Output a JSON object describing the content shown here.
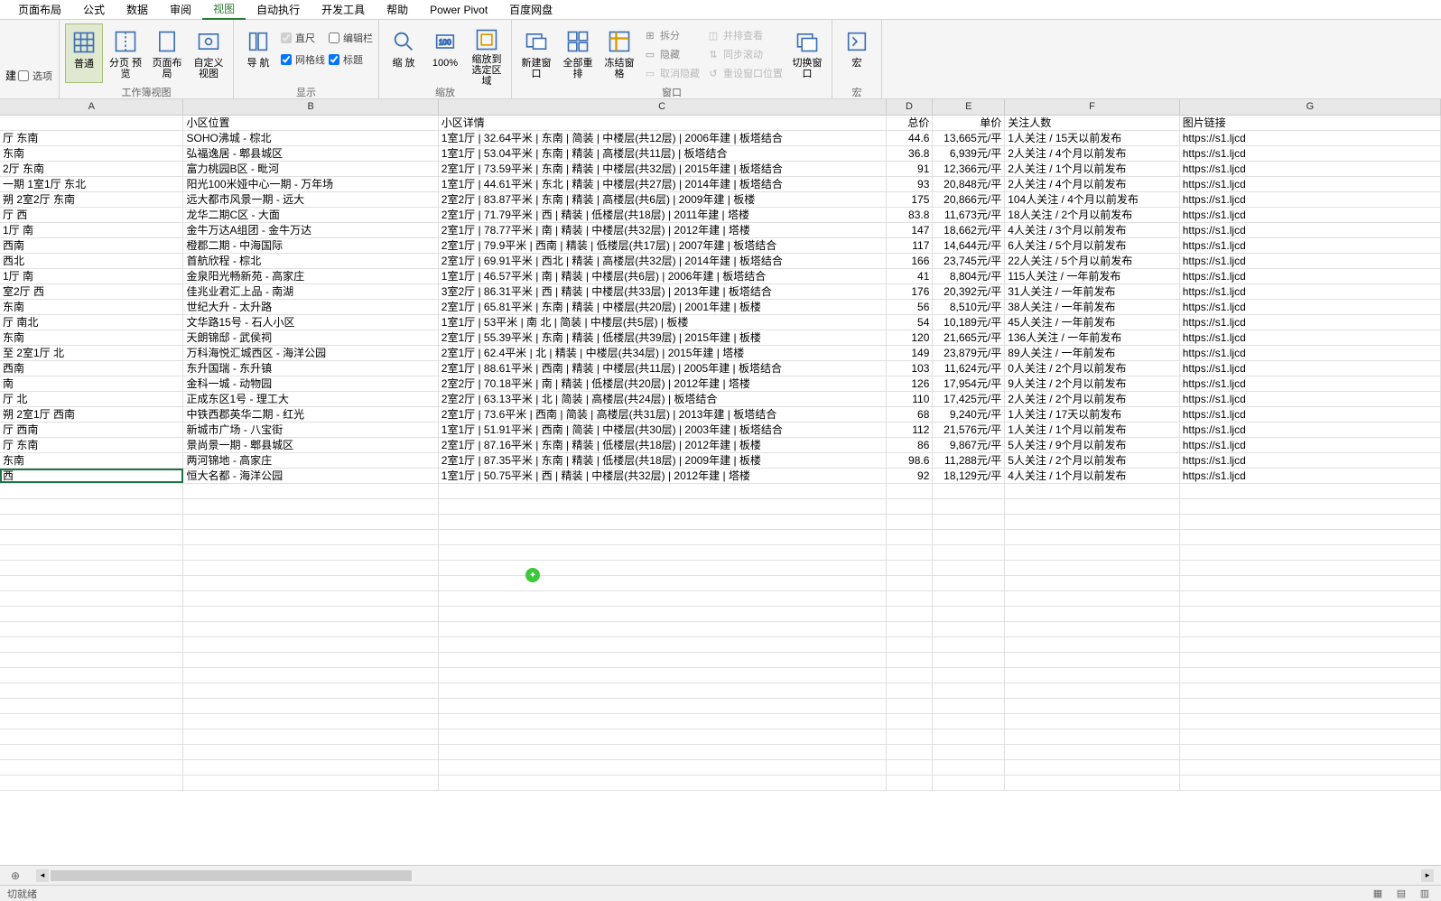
{
  "menubar": {
    "items": [
      "页面布局",
      "公式",
      "数据",
      "审阅",
      "视图",
      "自动执行",
      "开发工具",
      "帮助",
      "Power Pivot",
      "百度网盘"
    ],
    "active_index": 4
  },
  "ribbon": {
    "left_small": {
      "jian": "建",
      "xuanxiang": "选项"
    },
    "workbook_views": {
      "normal": "普通",
      "page_break": "分页\n预览",
      "page_layout": "页面布局",
      "custom": "自定义视图",
      "group": "工作簿视图"
    },
    "navigation": {
      "nav": "导\n航"
    },
    "show": {
      "ruler": "直尺",
      "formula_bar": "编辑栏",
      "gridlines": "网格线",
      "headings": "标题",
      "group": "显示"
    },
    "zoom": {
      "zoom": "缩\n放",
      "hundred": "100%",
      "to_selection": "缩放到\n选定区域",
      "group": "缩放"
    },
    "window": {
      "new_window": "新建窗口",
      "arrange_all": "全部重排",
      "freeze": "冻结窗格",
      "split": "拆分",
      "hide": "隐藏",
      "unhide": "取消隐藏",
      "side_by_side": "并排查看",
      "sync_scroll": "同步滚动",
      "reset_pos": "重设窗口位置",
      "switch": "切换窗口",
      "group": "窗口"
    },
    "macros": {
      "macros": "宏",
      "group": "宏"
    }
  },
  "columns": {
    "A": "A",
    "B": "B",
    "C": "C",
    "D": "D",
    "E": "E",
    "F": "F",
    "G": "G"
  },
  "headers_row": {
    "A": "",
    "B": "小区位置",
    "C": "小区详情",
    "D": "总价",
    "E": "单价",
    "F": "关注人数",
    "G": "图片链接"
  },
  "rows": [
    {
      "A": "厅 东南",
      "B": "SOHO沸城   - 棕北",
      "C": "1室1厅 | 32.64平米 | 东南 | 简装 | 中楼层(共12层) | 2006年建 | 板塔结合",
      "D": "44.6",
      "E": "13,665元/平",
      "F": "1人关注 / 15天以前发布",
      "G": "https://s1.ljcd"
    },
    {
      "A": "东南",
      "B": "弘福逸居   - 郫县城区",
      "C": "1室1厅 | 53.04平米 | 东南 | 精装 | 高楼层(共11层) | 板塔结合",
      "D": "36.8",
      "E": "6,939元/平",
      "F": "2人关注 / 4个月以前发布",
      "G": "https://s1.ljcd"
    },
    {
      "A": "2厅 东南",
      "B": "富力桃园B区   - 毗河",
      "C": "2室1厅 | 73.59平米 | 东南 | 精装 | 中楼层(共32层) | 2015年建 | 板塔结合",
      "D": "91",
      "E": "12,366元/平",
      "F": "2人关注 / 1个月以前发布",
      "G": "https://s1.ljcd"
    },
    {
      "A": "一期 1室1厅 东北",
      "B": "阳光100米娅中心一期   - 万年场",
      "C": "1室1厅 | 44.61平米 | 东北 | 精装 | 中楼层(共27层) | 2014年建 | 板塔结合",
      "D": "93",
      "E": "20,848元/平",
      "F": "2人关注 / 4个月以前发布",
      "G": "https://s1.ljcd"
    },
    {
      "A": "朔 2室2厅 东南",
      "B": "远大都市风景一期   - 远大",
      "C": "2室2厅 | 83.87平米 | 东南 | 精装 | 高楼层(共6层) | 2009年建 | 板楼",
      "D": "175",
      "E": "20,866元/平",
      "F": "104人关注 / 4个月以前发布",
      "G": "https://s1.ljcd"
    },
    {
      "A": "厅 西",
      "B": "龙华二期C区   - 大面",
      "C": "2室1厅 | 71.79平米 | 西 | 精装 | 低楼层(共18层) | 2011年建 | 塔楼",
      "D": "83.8",
      "E": "11,673元/平",
      "F": "18人关注 / 2个月以前发布",
      "G": "https://s1.ljcd"
    },
    {
      "A": "1厅 南",
      "B": "金牛万达A组团   - 金牛万达",
      "C": "2室1厅 | 78.77平米 | 南 | 精装 | 中楼层(共32层) | 2012年建 | 塔楼",
      "D": "147",
      "E": "18,662元/平",
      "F": "4人关注 / 3个月以前发布",
      "G": "https://s1.ljcd"
    },
    {
      "A": "西南",
      "B": "橙郡二期   - 中海国际",
      "C": "2室1厅 | 79.9平米 | 西南 | 精装 | 低楼层(共17层) | 2007年建 | 板塔结合",
      "D": "117",
      "E": "14,644元/平",
      "F": "6人关注 / 5个月以前发布",
      "G": "https://s1.ljcd"
    },
    {
      "A": "西北",
      "B": "首航欣程   - 棕北",
      "C": "2室1厅 | 69.91平米 | 西北 | 精装 | 高楼层(共32层) | 2014年建 | 板塔结合",
      "D": "166",
      "E": "23,745元/平",
      "F": "22人关注 / 5个月以前发布",
      "G": "https://s1.ljcd"
    },
    {
      "A": "1厅 南",
      "B": "金泉阳光畅新苑   - 高家庄",
      "C": "1室1厅 | 46.57平米 | 南 | 精装 | 中楼层(共6层) | 2006年建 | 板塔结合",
      "D": "41",
      "E": "8,804元/平",
      "F": "115人关注 / 一年前发布",
      "G": "https://s1.ljcd"
    },
    {
      "A": "室2厅 西",
      "B": "佳兆业君汇上品   - 南湖",
      "C": "3室2厅 | 86.31平米 | 西 | 精装 | 中楼层(共33层) | 2013年建 | 板塔结合",
      "D": "176",
      "E": "20,392元/平",
      "F": "31人关注 / 一年前发布",
      "G": "https://s1.ljcd"
    },
    {
      "A": "东南",
      "B": "世纪大升   - 太升路",
      "C": "2室1厅 | 65.81平米 | 东南 | 精装 | 中楼层(共20层) | 2001年建 | 板楼",
      "D": "56",
      "E": "8,510元/平",
      "F": "38人关注 / 一年前发布",
      "G": "https://s1.ljcd"
    },
    {
      "A": "厅 南北",
      "B": "文华路15号   - 石人小区",
      "C": "1室1厅 | 53平米 | 南 北 | 简装 | 中楼层(共5层) | 板楼",
      "D": "54",
      "E": "10,189元/平",
      "F": "45人关注 / 一年前发布",
      "G": "https://s1.ljcd"
    },
    {
      "A": "东南",
      "B": "天朗锦邸   - 武侯祠",
      "C": "2室1厅 | 55.39平米 | 东南 | 精装 | 低楼层(共39层) | 2015年建 | 板楼",
      "D": "120",
      "E": "21,665元/平",
      "F": "136人关注 / 一年前发布",
      "G": "https://s1.ljcd"
    },
    {
      "A": "至 2室1厅 北",
      "B": "万科海悦汇城西区   - 海洋公园",
      "C": "2室1厅 | 62.4平米 | 北 | 精装 | 中楼层(共34层) | 2015年建 | 塔楼",
      "D": "149",
      "E": "23,879元/平",
      "F": "89人关注 / 一年前发布",
      "G": "https://s1.ljcd"
    },
    {
      "A": "西南",
      "B": "东升国瑞   - 东升镇",
      "C": "2室1厅 | 88.61平米 | 西南 | 精装 | 中楼层(共11层) | 2005年建 | 板塔结合",
      "D": "103",
      "E": "11,624元/平",
      "F": "0人关注 / 2个月以前发布",
      "G": "https://s1.ljcd"
    },
    {
      "A": "南",
      "B": "金科一城   - 动物园",
      "C": "2室2厅 | 70.18平米 | 南 | 精装 | 低楼层(共20层) | 2012年建 | 塔楼",
      "D": "126",
      "E": "17,954元/平",
      "F": "9人关注 / 2个月以前发布",
      "G": "https://s1.ljcd"
    },
    {
      "A": "厅 北",
      "B": "正成东区1号   - 理工大",
      "C": "2室2厅 | 63.13平米 | 北 | 简装 | 高楼层(共24层) | 板塔结合",
      "D": "110",
      "E": "17,425元/平",
      "F": "2人关注 / 2个月以前发布",
      "G": "https://s1.ljcd"
    },
    {
      "A": "朔 2室1厅 西南",
      "B": "中铁西郡英华二期   - 红光",
      "C": "2室1厅 | 73.6平米 | 西南 | 简装 | 高楼层(共31层) | 2013年建 | 板塔结合",
      "D": "68",
      "E": "9,240元/平",
      "F": "1人关注 / 17天以前发布",
      "G": "https://s1.ljcd"
    },
    {
      "A": "厅 西南",
      "B": "新城市广场   - 八宝街",
      "C": "1室1厅 | 51.91平米 | 西南 | 简装 | 中楼层(共30层) | 2003年建 | 板塔结合",
      "D": "112",
      "E": "21,576元/平",
      "F": "1人关注 / 1个月以前发布",
      "G": "https://s1.ljcd"
    },
    {
      "A": "厅 东南",
      "B": "景尚景一期   - 郫县城区",
      "C": "2室1厅 | 87.16平米 | 东南 | 精装 | 低楼层(共18层) | 2012年建 | 板楼",
      "D": "86",
      "E": "9,867元/平",
      "F": "5人关注 / 9个月以前发布",
      "G": "https://s1.ljcd"
    },
    {
      "A": "东南",
      "B": "两河锦地   - 高家庄",
      "C": "2室1厅 | 87.35平米 | 东南 | 精装 | 低楼层(共18层) | 2009年建 | 板楼",
      "D": "98.6",
      "E": "11,288元/平",
      "F": "5人关注 / 2个月以前发布",
      "G": "https://s1.ljcd"
    },
    {
      "A": "西",
      "B": "恒大名都   - 海洋公园",
      "C": "1室1厅 | 50.75平米 | 西 | 精装 | 中楼层(共32层) | 2012年建 | 塔楼",
      "D": "92",
      "E": "18,129元/平",
      "F": "4人关注 / 1个月以前发布",
      "G": "https://s1.ljcd"
    }
  ],
  "selected_cell_index": 22,
  "statusbar": {
    "ready": "切就绪"
  }
}
